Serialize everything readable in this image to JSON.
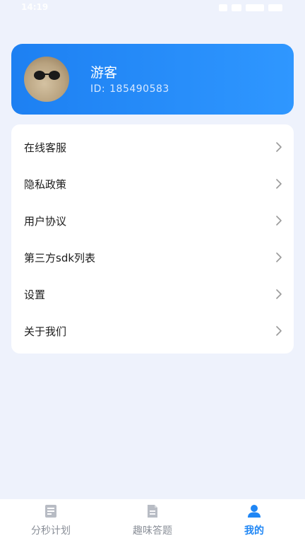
{
  "status_bar": {
    "time": "14:19"
  },
  "profile": {
    "name": "游客",
    "id_label": "ID:",
    "id_value": "185490583"
  },
  "menu": {
    "items": [
      {
        "label": "在线客服"
      },
      {
        "label": "隐私政策"
      },
      {
        "label": "用户协议"
      },
      {
        "label": "第三方sdk列表"
      },
      {
        "label": "设置"
      },
      {
        "label": "关于我们"
      }
    ]
  },
  "tabbar": {
    "tabs": [
      {
        "label": "分秒计划",
        "icon": "plan-icon",
        "active": false
      },
      {
        "label": "趣味答题",
        "icon": "document-icon",
        "active": false
      },
      {
        "label": "我的",
        "icon": "user-icon",
        "active": true
      }
    ]
  },
  "colors": {
    "accent": "#1f86f5",
    "background": "#eef2fc",
    "card": "#ffffff",
    "inactive_tab": "#8a8f98"
  }
}
